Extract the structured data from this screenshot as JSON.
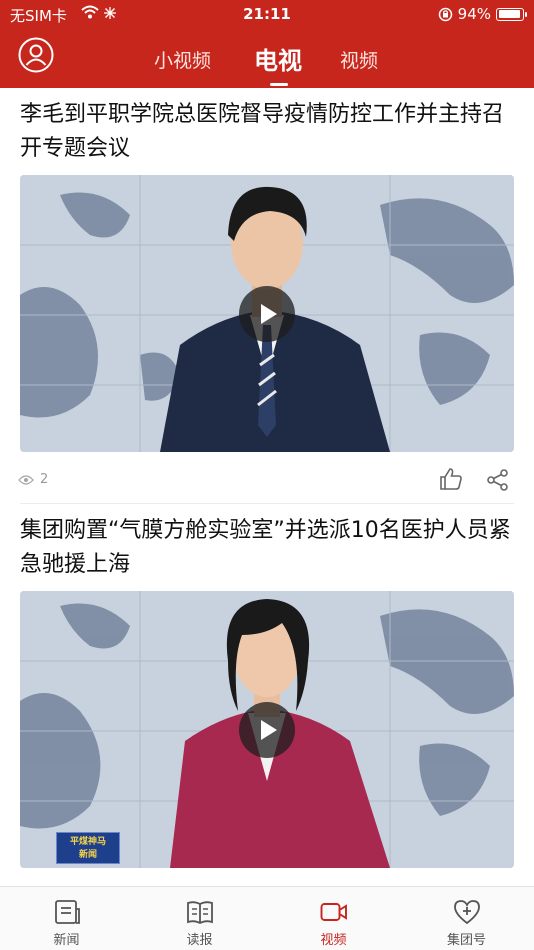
{
  "status_bar": {
    "carrier": "无SIM卡",
    "time": "21:11",
    "battery_percent": "94%",
    "battery_level": 0.94
  },
  "header": {
    "tabs": [
      {
        "label": "小视频",
        "active": false
      },
      {
        "label": "电视",
        "active": true
      },
      {
        "label": "视频",
        "active": false
      }
    ],
    "avatar_icon": "user-avatar-icon"
  },
  "feed": {
    "items": [
      {
        "title": "李毛到平职学院总医院督导疫情防控工作并主持召开专题会议",
        "thumbnail_desc": "news-anchor-male",
        "views": "2",
        "like_icon": "thumb-up-icon",
        "share_icon": "share-icon"
      },
      {
        "title": "集团购置“气膜方舱实验室”并选派10名医护人员紧急驰援上海",
        "thumbnail_desc": "news-anchor-female",
        "logo_text_line1": "平煤神马",
        "logo_text_line2": "新闻"
      }
    ]
  },
  "bottom_nav": {
    "items": [
      {
        "label": "新闻",
        "icon": "news-icon",
        "active": false
      },
      {
        "label": "读报",
        "icon": "newspaper-book-icon",
        "active": false
      },
      {
        "label": "视频",
        "icon": "video-camera-icon",
        "active": true
      },
      {
        "label": "集团号",
        "icon": "heart-plus-icon",
        "active": false
      }
    ]
  },
  "colors": {
    "brand_red": "#c6261c",
    "active_nav": "#c6261c",
    "muted_text": "#9a9a9a"
  }
}
